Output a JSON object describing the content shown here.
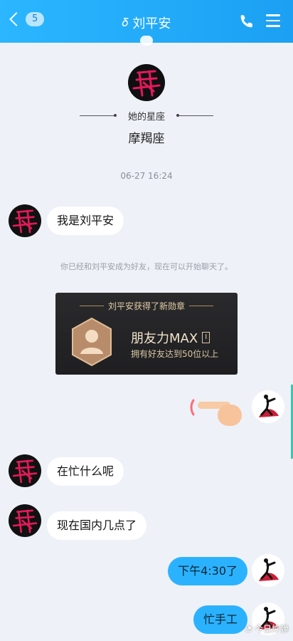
{
  "header": {
    "unread_count": "5",
    "title": "刘平安",
    "accent": "#1ba0f3"
  },
  "icons": {
    "back": "chevron-left-icon",
    "hearing": "ear-icon",
    "phone": "phone-icon",
    "menu": "menu-icon"
  },
  "profile": {
    "constellation_label": "她的星座",
    "constellation_value": "摩羯座"
  },
  "timestamp": "06-27 16:24",
  "messages": [
    {
      "sender": "them",
      "text": "我是刘平安"
    },
    {
      "sender": "them",
      "text": "在忙什么呢"
    },
    {
      "sender": "them",
      "text": "现在国内几点了"
    },
    {
      "sender": "me",
      "text": "下午4:30了"
    },
    {
      "sender": "me",
      "text": "忙手工"
    }
  ],
  "system_note": "你已经和刘平安成为好友，现在可以开始聊天了。",
  "medal": {
    "header": "刘平安获得了新勋章",
    "name": "朋友力MAX",
    "level": "I",
    "description": "拥有好友达到50位以上"
  },
  "watermark": "今日炸弹"
}
